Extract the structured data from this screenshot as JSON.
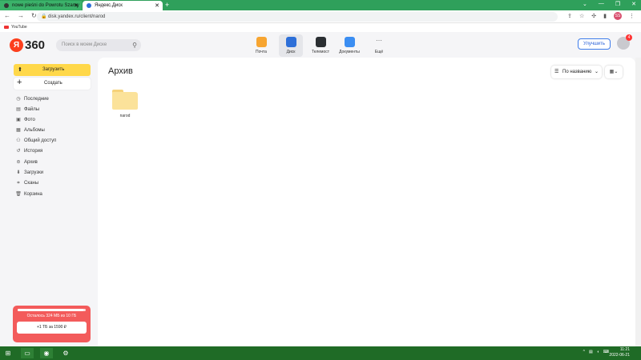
{
  "browser": {
    "tabs": [
      {
        "label": "nowe pieśni do Powrotu Szamy",
        "active": false
      },
      {
        "label": "Яндекс.Диск",
        "active": true
      }
    ],
    "new_tab": "+",
    "url": "disk.yandex.ru/client/narod",
    "bookmarks": [
      {
        "label": "YouTube"
      }
    ],
    "profile_initials": "SS"
  },
  "header": {
    "logo_text": "360",
    "logo_letter": "Я",
    "search_placeholder": "Поиск в моем Диске",
    "apps": [
      {
        "label": "Почта",
        "color": "#f7a531"
      },
      {
        "label": "Диск",
        "color": "#2d6fd8"
      },
      {
        "label": "Телемост",
        "color": "#2b2f33"
      },
      {
        "label": "Документы",
        "color": "#3b8ef2"
      },
      {
        "label": "Ещё",
        "color": ""
      }
    ],
    "upgrade_label": "Улучшить",
    "notification_count": "4"
  },
  "sidebar": {
    "upload_label": "Загрузить",
    "create_label": "Создать",
    "items": [
      {
        "label": "Последние",
        "icon": "clock-icon"
      },
      {
        "label": "Файлы",
        "icon": "files-icon"
      },
      {
        "label": "Фото",
        "icon": "photo-icon"
      },
      {
        "label": "Альбомы",
        "icon": "albums-icon"
      },
      {
        "label": "Общий доступ",
        "icon": "share-icon"
      },
      {
        "label": "История",
        "icon": "history-icon"
      },
      {
        "label": "Архив",
        "icon": "archive-icon"
      },
      {
        "label": "Загрузки",
        "icon": "downloads-icon"
      },
      {
        "label": "Сканы",
        "icon": "scans-icon"
      },
      {
        "label": "Корзина",
        "icon": "trash-icon"
      }
    ],
    "storage": {
      "text": "Осталось 324 МБ из 10 ГБ",
      "used_fraction": 0.97,
      "button_label": "+1 ТБ за 1590 ₽"
    }
  },
  "main": {
    "title": "Архив",
    "sort_label": "По названию",
    "folders": [
      {
        "name": "narod"
      }
    ]
  },
  "taskbar": {
    "time": "11:21",
    "date": "2022-06-21"
  },
  "colors": {
    "accent_yellow": "#ffd84a",
    "storage_red": "#f35b5b",
    "taskbar_green": "#1f6b26",
    "tabbar_green": "#2fa05b"
  }
}
